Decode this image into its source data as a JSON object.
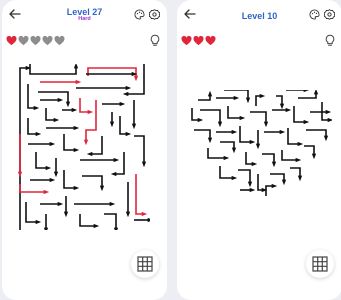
{
  "screens": [
    {
      "title": "Level 27",
      "subtitle": "Hard",
      "lives_total": 5,
      "lives_remaining": 1,
      "icons": [
        "back-arrow-icon",
        "palette-icon",
        "gear-icon",
        "lightbulb-icon",
        "grid-icon"
      ],
      "maze_shape": "square"
    },
    {
      "title": "Level 10",
      "subtitle": "",
      "lives_total": 3,
      "lives_remaining": 3,
      "icons": [
        "back-arrow-icon",
        "palette-icon",
        "gear-icon",
        "lightbulb-icon",
        "grid-icon"
      ],
      "maze_shape": "heart"
    }
  ],
  "colors": {
    "title_blue": "#2f64c8",
    "difficulty_purple": "#9a35d6",
    "heart_red": "#e0263a",
    "heart_grey": "#8d8d8d",
    "maze_line": "#111111",
    "maze_highlight": "#e0263a"
  }
}
